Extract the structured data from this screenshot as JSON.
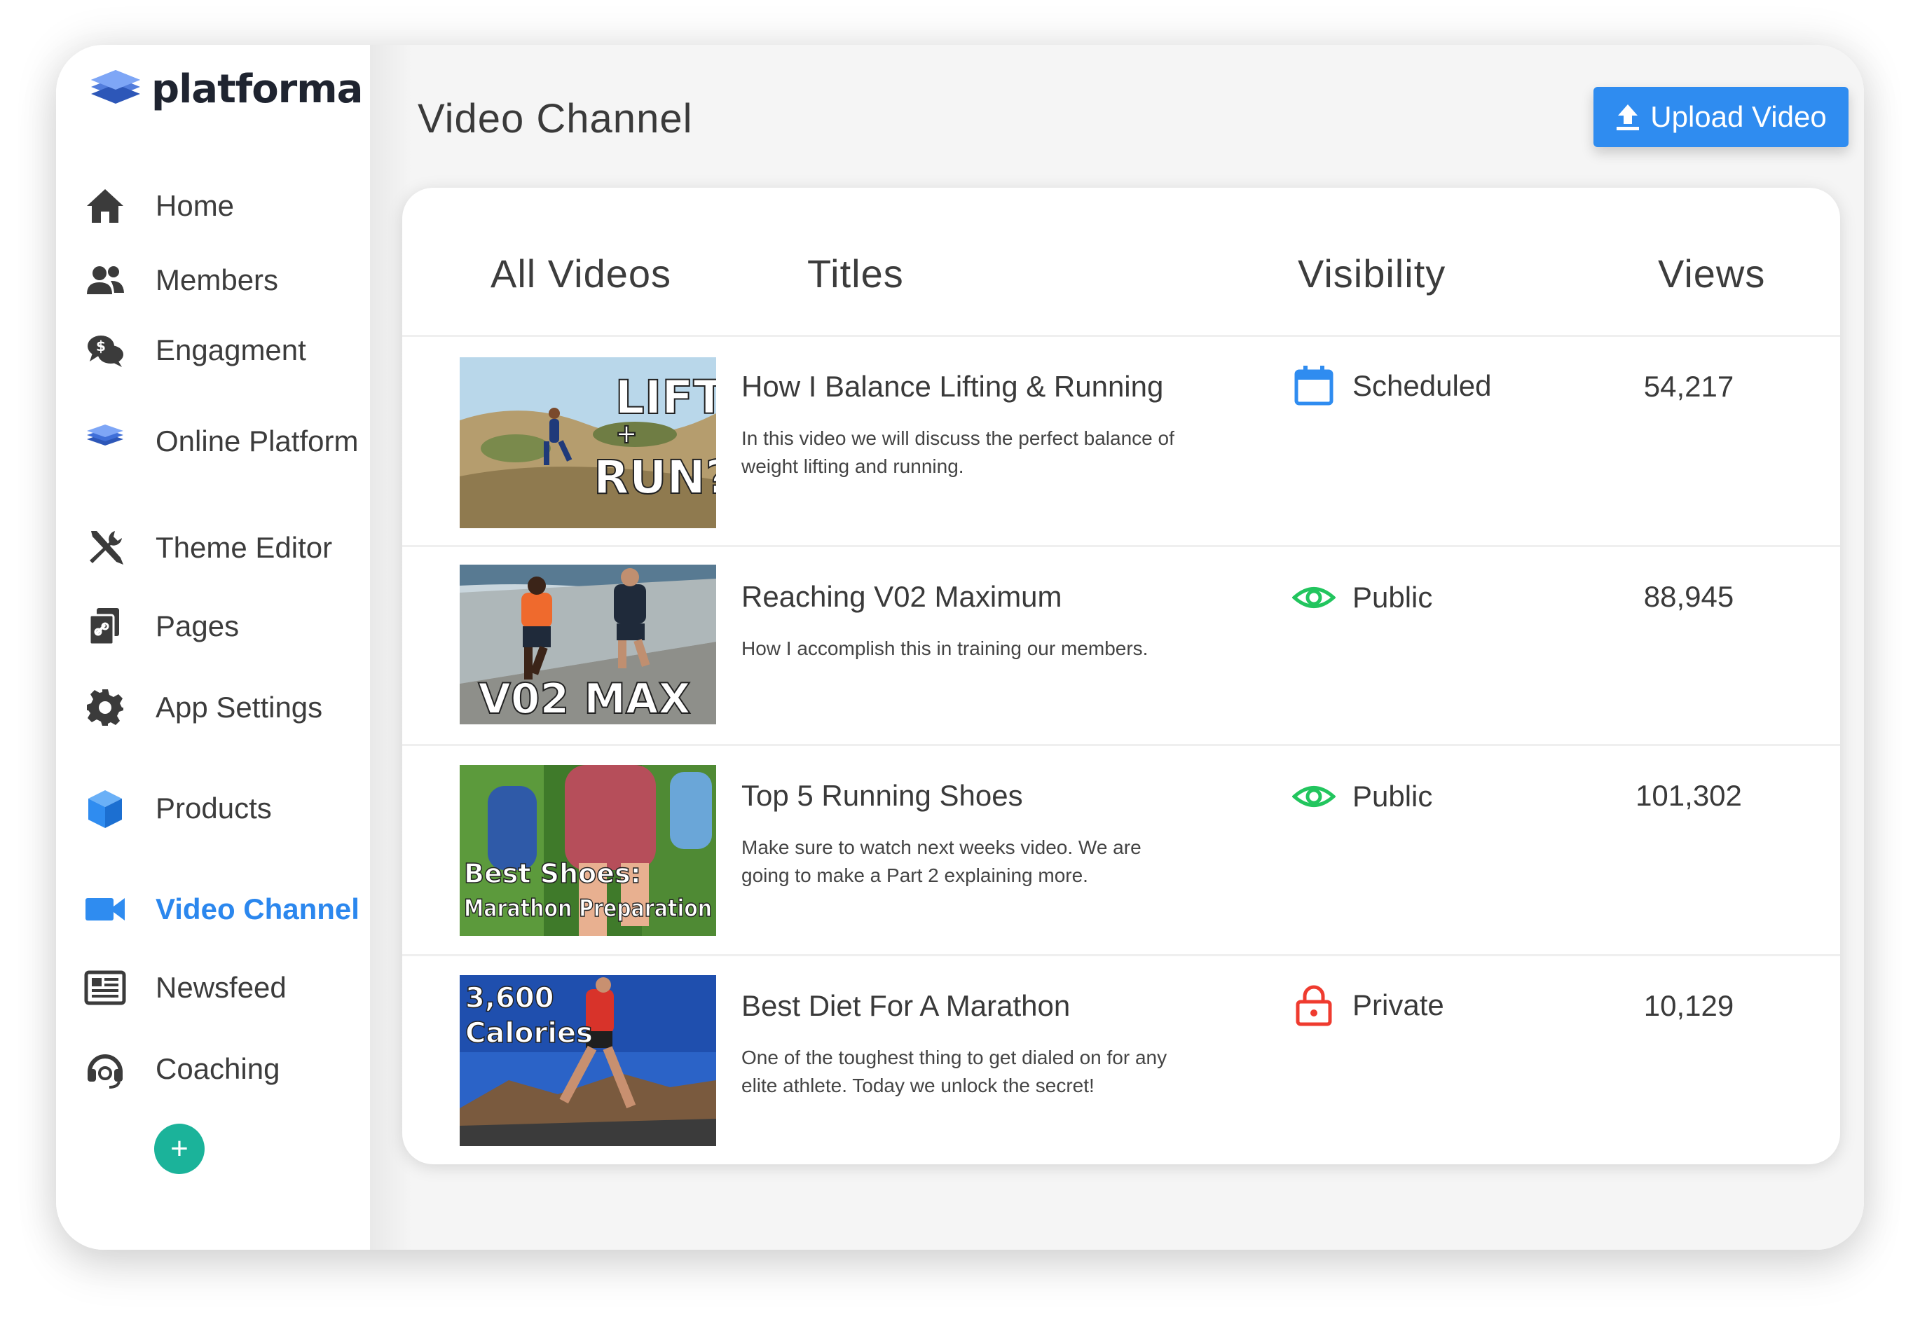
{
  "brand": {
    "name": "platforma",
    "accent": "#2b87ee"
  },
  "sidebar": {
    "items": [
      {
        "label": "Home",
        "icon": "home-icon"
      },
      {
        "label": "Members",
        "icon": "members-icon"
      },
      {
        "label": "Engagment",
        "icon": "engagement-icon"
      },
      {
        "label": "Online Platform",
        "icon": "layers-icon"
      },
      {
        "label": "Theme Editor",
        "icon": "tools-icon"
      },
      {
        "label": "Pages",
        "icon": "pages-icon"
      },
      {
        "label": "App Settings",
        "icon": "gear-icon"
      },
      {
        "label": "Products",
        "icon": "cube-icon"
      },
      {
        "label": "Video Channel",
        "icon": "video-camera-icon",
        "active": true
      },
      {
        "label": "Newsfeed",
        "icon": "newspaper-icon"
      },
      {
        "label": "Coaching",
        "icon": "headset-icon"
      }
    ],
    "add_label": "+"
  },
  "header": {
    "title": "Video Channel",
    "upload_label": "Upload Video"
  },
  "table": {
    "columns": [
      "All Videos",
      "Titles",
      "Visibility",
      "Views"
    ],
    "rows": [
      {
        "thumb_text": [
          "LIFT",
          "+",
          "RUN?"
        ],
        "title": "How I Balance Lifting & Running",
        "description": "In this video we will discuss the perfect balance of weight lifting and running.",
        "visibility": "Scheduled",
        "visibility_icon": "calendar-icon",
        "visibility_color": "#2f8cf0",
        "views": "54,217"
      },
      {
        "thumb_text": [
          "V02 MAX"
        ],
        "title": "Reaching V02 Maximum",
        "description": "How I accomplish this in training our members.",
        "visibility": "Public",
        "visibility_icon": "eye-icon",
        "visibility_color": "#22c55e",
        "views": "88,945"
      },
      {
        "thumb_text": [
          "Best Shoes:",
          "Marathon Preparation"
        ],
        "title": "Top 5 Running Shoes",
        "description": "Make sure to watch next weeks video. We are going to make a Part 2 explaining more.",
        "visibility": "Public",
        "visibility_icon": "eye-icon",
        "visibility_color": "#22c55e",
        "views": "101,302"
      },
      {
        "thumb_text": [
          "3,600",
          "Calories"
        ],
        "title": "Best Diet For A Marathon",
        "description": "One of the toughest thing to get dialed on for any elite athlete. Today we unlock the secret!",
        "visibility": "Private",
        "visibility_icon": "lock-icon",
        "visibility_color": "#ef3b2f",
        "views": "10,129"
      }
    ]
  }
}
